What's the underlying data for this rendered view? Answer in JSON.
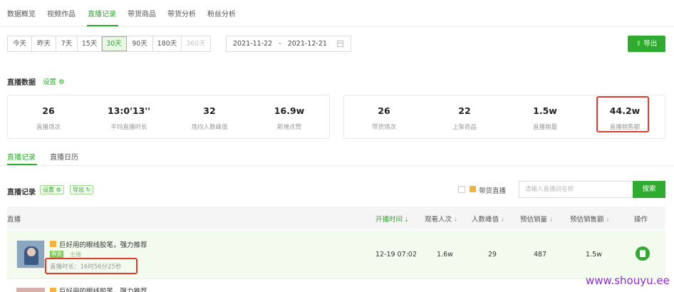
{
  "top_tabs": [
    "数据概览",
    "视频作品",
    "直播记录",
    "带货商品",
    "带货分析",
    "粉丝分析"
  ],
  "periods": [
    "今天",
    "昨天",
    "7天",
    "15天",
    "30天",
    "90天",
    "180天",
    "360天"
  ],
  "date_range": {
    "start": "2021-11-22",
    "separator": "-",
    "end": "2021-12-21"
  },
  "export_label": "导出",
  "live_data": {
    "title": "直播数据",
    "settings": "设置"
  },
  "stats_left": [
    {
      "value": "26",
      "label": "直播场次"
    },
    {
      "value": "13:0'13''",
      "label": "平均直播时长"
    },
    {
      "value": "32",
      "label": "场均人数峰值"
    },
    {
      "value": "16.9w",
      "label": "新增点赞"
    }
  ],
  "stats_right": [
    {
      "value": "26",
      "label": "带货场次"
    },
    {
      "value": "22",
      "label": "上架商品"
    },
    {
      "value": "1.5w",
      "label": "直播销量"
    },
    {
      "value": "44.2w",
      "label": "直播销售额"
    }
  ],
  "sub_tabs": [
    "直播记录",
    "直播日历"
  ],
  "records": {
    "title": "直播记录",
    "settings_tag": "设置",
    "export_tag": "导出",
    "filter_label": "带货直播",
    "search_placeholder": "请输入直播间名称",
    "search_button": "搜索"
  },
  "table": {
    "headers": [
      "直播",
      "开播时间",
      "观看人次",
      "人数峰值",
      "预估销量",
      "预估销售额",
      "操作"
    ],
    "row": {
      "title": "巨好用的眼线胶笔，强力推荐",
      "tag": "带货",
      "host": "主播",
      "duration": "直播时长：16时56分25秒",
      "start_time": "12-19 07:02",
      "viewers": "1.6w",
      "peak": "29",
      "sales": "487",
      "revenue": "1.5w"
    },
    "next_row_title": "巨好用的眼线胶笔，强力推荐"
  },
  "watermark": "www.shouyu.ee",
  "colors": {
    "accent": "#2fab2f",
    "highlight": "#e03a2e",
    "tag_orange": "#f4b43a"
  }
}
